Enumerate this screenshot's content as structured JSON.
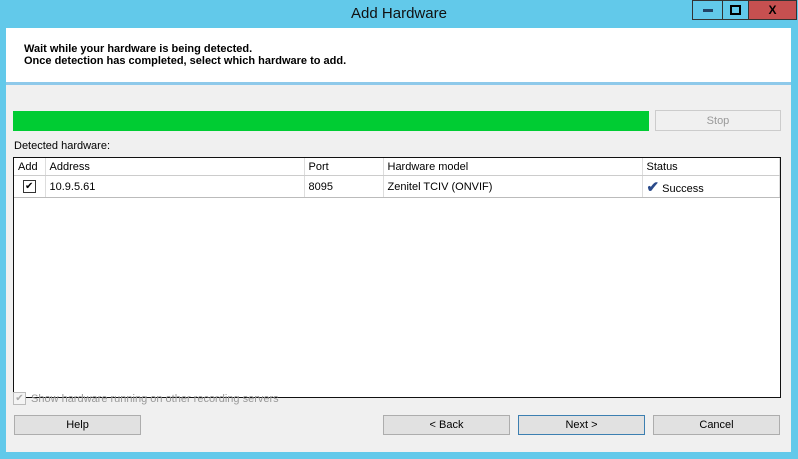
{
  "window": {
    "title": "Add Hardware",
    "minimize": "▁",
    "maximize": "□",
    "close": "X"
  },
  "header": {
    "line1": "Wait while your hardware is being detected.",
    "line2": "Once detection has completed, select which hardware to add."
  },
  "progress": {
    "percent": 100,
    "color": "#00cc33"
  },
  "stop_label": "Stop",
  "detected_label": "Detected hardware:",
  "table": {
    "columns": [
      "Add",
      "Address",
      "Port",
      "Hardware model",
      "Status"
    ],
    "rows": [
      {
        "add": true,
        "address": "10.9.5.61",
        "port": "8095",
        "model": "Zenitel TCIV (ONVIF)",
        "status": "Success"
      }
    ]
  },
  "show_other_label": "Show hardware running on other recording servers",
  "buttons": {
    "help": "Help",
    "back": "< Back",
    "next": "Next >",
    "cancel": "Cancel"
  }
}
